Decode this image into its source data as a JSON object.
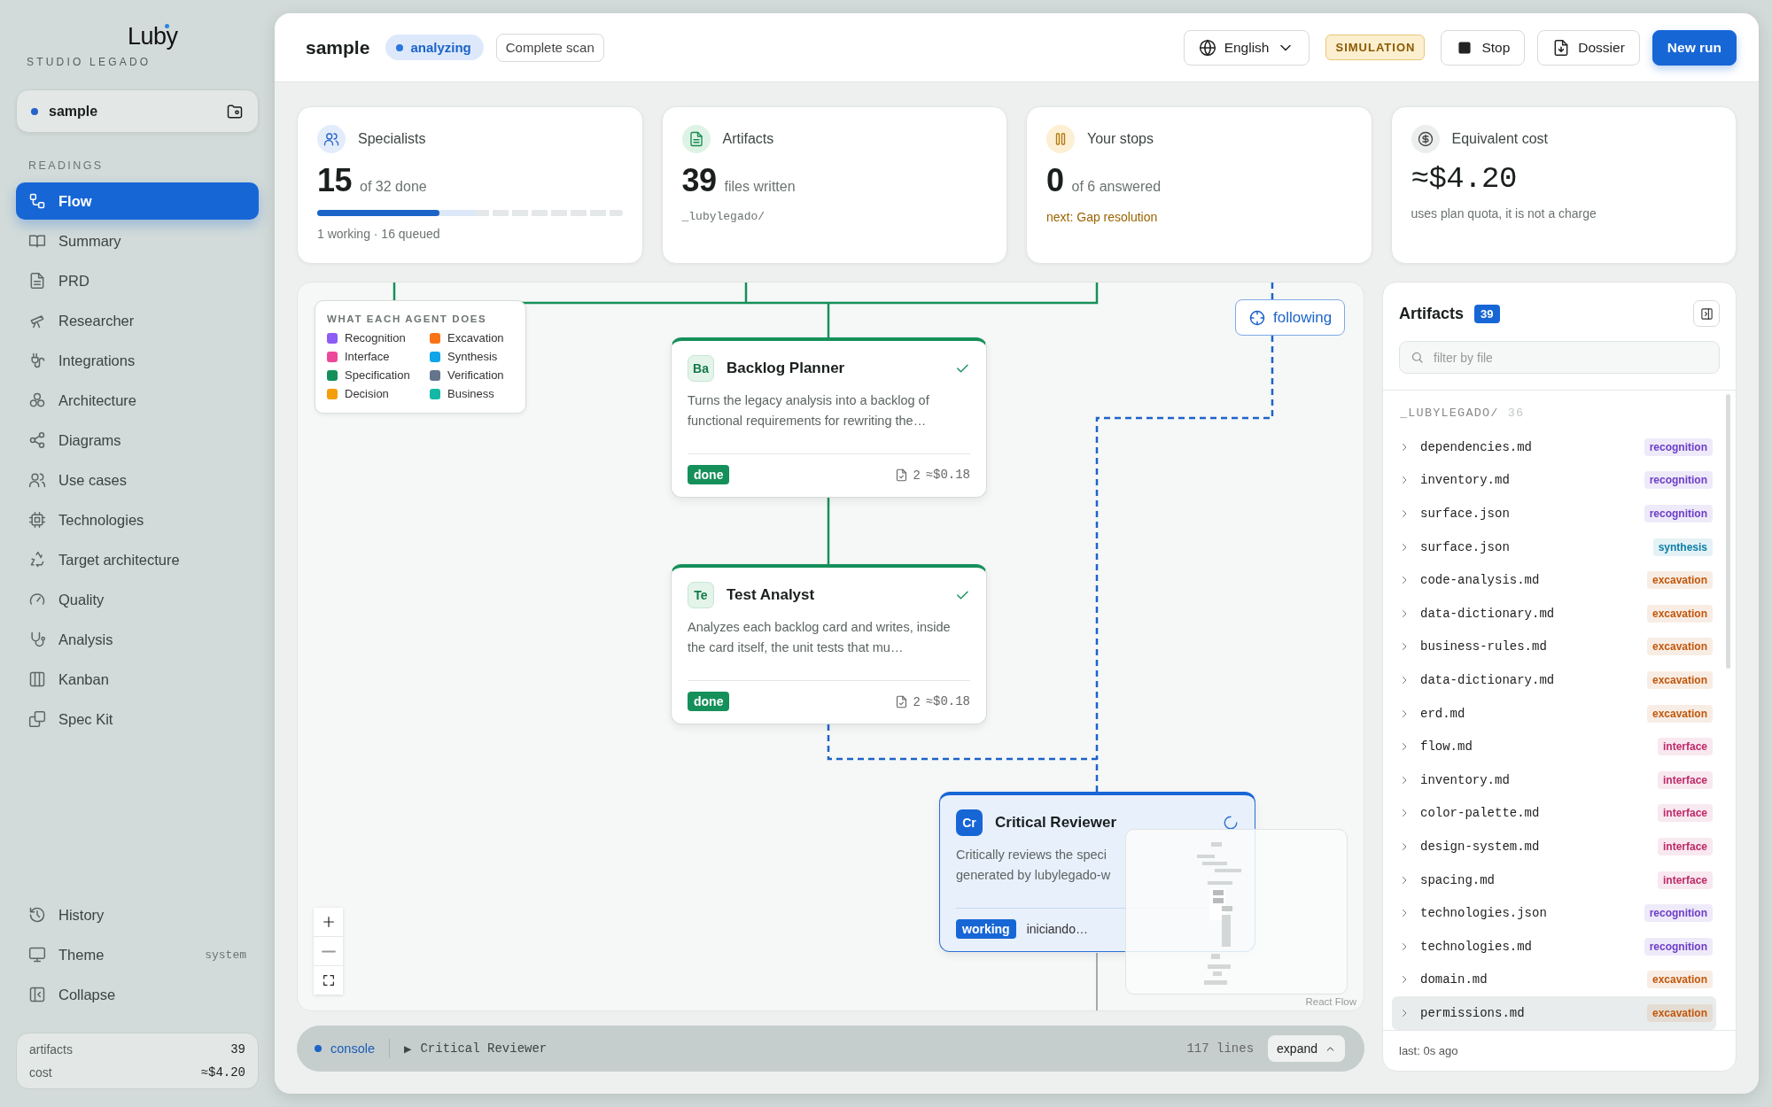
{
  "sidebar": {
    "brand": "Luby",
    "subtitle": "STUDIO LEGADO",
    "project": "sample",
    "section": "READINGS",
    "items": [
      {
        "label": "Flow",
        "selected": true
      },
      {
        "label": "Summary",
        "selected": false
      },
      {
        "label": "PRD",
        "selected": false
      },
      {
        "label": "Researcher",
        "selected": false
      },
      {
        "label": "Integrations",
        "selected": false
      },
      {
        "label": "Architecture",
        "selected": false
      },
      {
        "label": "Diagrams",
        "selected": false
      },
      {
        "label": "Use cases",
        "selected": false
      },
      {
        "label": "Technologies",
        "selected": false
      },
      {
        "label": "Target architecture",
        "selected": false
      },
      {
        "label": "Quality",
        "selected": false
      },
      {
        "label": "Analysis",
        "selected": false
      },
      {
        "label": "Kanban",
        "selected": false
      },
      {
        "label": "Spec Kit",
        "selected": false
      }
    ],
    "footer_items": [
      {
        "label": "History"
      },
      {
        "label": "Theme",
        "value": "system"
      },
      {
        "label": "Collapse"
      }
    ],
    "summary": [
      {
        "label": "artifacts",
        "value": "39"
      },
      {
        "label": "cost",
        "value": "≈$4.20"
      }
    ]
  },
  "header": {
    "title": "sample",
    "status": "analyzing",
    "scan": "Complete scan",
    "language": "English",
    "mode": "SIMULATION",
    "buttons": [
      {
        "label": "Stop",
        "kind": "stop"
      },
      {
        "label": "Dossier",
        "kind": "dossier"
      },
      {
        "label": "New run",
        "kind": "primary"
      }
    ]
  },
  "stats": [
    {
      "kind": "progress",
      "label": "Specialists",
      "value": "15",
      "suffix": "of 32 done",
      "level": 0.4,
      "note": "1 working · 16 queued"
    },
    {
      "kind": "path",
      "label": "Artifacts",
      "value": "39",
      "suffix": "files written",
      "note": "_lubylegado/"
    },
    {
      "kind": "next",
      "label": "Your stops",
      "value": "0",
      "suffix": "of 6 answered",
      "note": "next: Gap resolution"
    },
    {
      "kind": "cost",
      "label": "Equivalent cost",
      "value": "≈$4.20",
      "note": "uses plan quota, it is not a charge"
    }
  ],
  "flow": {
    "legend": {
      "title": "WHAT EACH AGENT DOES",
      "items": [
        {
          "label": "Recognition",
          "color": "#8b5cf6"
        },
        {
          "label": "Excavation",
          "color": "#f97316"
        },
        {
          "label": "Interface",
          "color": "#ec4899"
        },
        {
          "label": "Synthesis",
          "color": "#0ea5e9"
        },
        {
          "label": "Specification",
          "color": "#15905a"
        },
        {
          "label": "Verification",
          "color": "#64748b"
        },
        {
          "label": "Decision",
          "color": "#f59e0b"
        },
        {
          "label": "Business",
          "color": "#14b8a6"
        }
      ]
    },
    "follow_button": "following",
    "nodes": [
      {
        "kind": "done",
        "initials": "Ba",
        "title": "Backlog Planner",
        "description": [
          "Turns the legacy analysis into a backlog of functional requirements for rewriting the…"
        ],
        "status": "done",
        "files": "2",
        "cost": "≈$0.18"
      },
      {
        "kind": "done",
        "initials": "Te",
        "title": "Test Analyst",
        "description": [
          "Analyzes each backlog card and writes, inside the card itself, the unit tests that mu…"
        ],
        "status": "done",
        "files": "2",
        "cost": "≈$0.18"
      },
      {
        "kind": "working",
        "initials": "Cr",
        "title": "Critical Reviewer",
        "description": [
          "Critically reviews the speci",
          "generated by lubylegado-w"
        ],
        "status": "working",
        "progress": "iniciando…"
      }
    ],
    "attribution": "React Flow"
  },
  "console": {
    "label": "console",
    "arrow": "▶",
    "agent": "Critical Reviewer",
    "lines": "117 lines",
    "expand": "expand"
  },
  "artifacts": {
    "title": "Artifacts",
    "count": "39",
    "placeholder": "filter by file",
    "folder": "_LUBYLEGADO/",
    "folder_count": "36",
    "files": [
      {
        "name": "dependencies.md",
        "tag": "recognition",
        "color": "#6d3fc8",
        "selected": false
      },
      {
        "name": "inventory.md",
        "tag": "recognition",
        "color": "#6d3fc8",
        "selected": false
      },
      {
        "name": "surface.json",
        "tag": "recognition",
        "color": "#6d3fc8",
        "selected": false
      },
      {
        "name": "surface.json",
        "tag": "synthesis",
        "color": "#0b7fa6",
        "selected": false
      },
      {
        "name": "code-analysis.md",
        "tag": "excavation",
        "color": "#c2570c",
        "selected": false
      },
      {
        "name": "data-dictionary.md",
        "tag": "excavation",
        "color": "#c2570c",
        "selected": false
      },
      {
        "name": "business-rules.md",
        "tag": "excavation",
        "color": "#c2570c",
        "selected": false
      },
      {
        "name": "data-dictionary.md",
        "tag": "excavation",
        "color": "#c2570c",
        "selected": false
      },
      {
        "name": "erd.md",
        "tag": "excavation",
        "color": "#c2570c",
        "selected": false
      },
      {
        "name": "flow.md",
        "tag": "interface",
        "color": "#be2a6b",
        "selected": false
      },
      {
        "name": "inventory.md",
        "tag": "interface",
        "color": "#be2a6b",
        "selected": false
      },
      {
        "name": "color-palette.md",
        "tag": "interface",
        "color": "#be2a6b",
        "selected": false
      },
      {
        "name": "design-system.md",
        "tag": "interface",
        "color": "#be2a6b",
        "selected": false
      },
      {
        "name": "spacing.md",
        "tag": "interface",
        "color": "#be2a6b",
        "selected": false
      },
      {
        "name": "technologies.json",
        "tag": "recognition",
        "color": "#6d3fc8",
        "selected": false
      },
      {
        "name": "technologies.md",
        "tag": "recognition",
        "color": "#6d3fc8",
        "selected": false
      },
      {
        "name": "domain.md",
        "tag": "excavation",
        "color": "#c2570c",
        "selected": false
      },
      {
        "name": "permissions.md",
        "tag": "excavation",
        "color": "#c2570c",
        "selected": true
      }
    ],
    "footer": "last: 0s ago"
  }
}
